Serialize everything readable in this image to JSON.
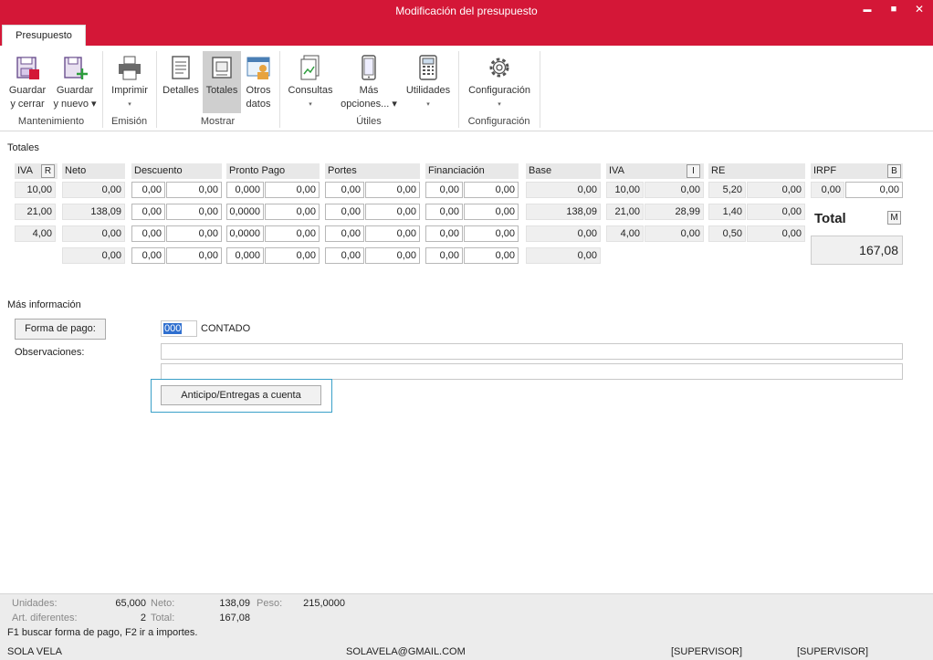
{
  "window": {
    "title": "Modificación del presupuesto",
    "minimize_glyph": "▬",
    "maximize_glyph": "■",
    "close_glyph": "✕"
  },
  "tabs": {
    "active": "Presupuesto"
  },
  "ribbon": {
    "buttons": {
      "guardar_cerrar": {
        "l1": "Guardar",
        "l2": "y cerrar"
      },
      "guardar_nuevo": {
        "l1": "Guardar",
        "l2": "y nuevo ▾"
      },
      "imprimir": {
        "l1": "Imprimir",
        "arrow": "▾"
      },
      "detalles": {
        "l1": "Detalles"
      },
      "totales": {
        "l1": "Totales"
      },
      "otros_datos": {
        "l1": "Otros",
        "l2": "datos"
      },
      "consultas": {
        "l1": "Consultas",
        "arrow": "▾"
      },
      "mas_opciones": {
        "l1": "Más",
        "l2": "opciones... ▾"
      },
      "utilidades": {
        "l1": "Utilidades",
        "arrow": "▾"
      },
      "configuracion": {
        "l1": "Configuración",
        "arrow": "▾"
      }
    },
    "groups": {
      "mantenimiento": "Mantenimiento",
      "emision": "Emisión",
      "mostrar": "Mostrar",
      "utiles": "Útiles",
      "configuracion": "Configuración"
    }
  },
  "totales": {
    "title": "Totales",
    "headers": {
      "iva": "IVA",
      "iva_btn": "R",
      "neto": "Neto",
      "descuento": "Descuento",
      "pronto_pago": "Pronto Pago",
      "portes": "Portes",
      "financiacion": "Financiación",
      "base": "Base",
      "iva2": "IVA",
      "iva2_btn": "I",
      "re": "RE",
      "irpf": "IRPF",
      "irpf_btn": "B"
    },
    "rows": [
      {
        "iva": "10,00",
        "neto": "0,00",
        "dto_p": "0,00",
        "dto_v": "0,00",
        "pp_p": "0,000",
        "pp_v": "0,00",
        "por_p": "0,00",
        "por_v": "0,00",
        "fin_p": "0,00",
        "fin_v": "0,00",
        "base": "0,00",
        "iva_p": "10,00",
        "iva_v": "0,00",
        "re_p": "5,20",
        "re_v": "0,00"
      },
      {
        "iva": "21,00",
        "neto": "138,09",
        "dto_p": "0,00",
        "dto_v": "0,00",
        "pp_p": "0,0000",
        "pp_v": "0,00",
        "por_p": "0,00",
        "por_v": "0,00",
        "fin_p": "0,00",
        "fin_v": "0,00",
        "base": "138,09",
        "iva_p": "21,00",
        "iva_v": "28,99",
        "re_p": "1,40",
        "re_v": "0,00"
      },
      {
        "iva": "4,00",
        "neto": "0,00",
        "dto_p": "0,00",
        "dto_v": "0,00",
        "pp_p": "0,0000",
        "pp_v": "0,00",
        "por_p": "0,00",
        "por_v": "0,00",
        "fin_p": "0,00",
        "fin_v": "0,00",
        "base": "0,00",
        "iva_p": "4,00",
        "iva_v": "0,00",
        "re_p": "0,50",
        "re_v": "0,00"
      }
    ],
    "sum_row": {
      "neto": "0,00",
      "dto_p": "0,00",
      "dto_v": "0,00",
      "pp_p": "0,000",
      "pp_v": "0,00",
      "por_p": "0,00",
      "por_v": "0,00",
      "fin_p": "0,00",
      "fin_v": "0,00",
      "base": "0,00"
    },
    "irpf": {
      "pct": "0,00",
      "val": "0,00"
    },
    "total_label": "Total",
    "total_btn": "M",
    "total_value": "167,08"
  },
  "mas_info": {
    "title": "Más información",
    "forma_pago_btn": "Forma de pago:",
    "forma_pago_code": "000",
    "forma_pago_name": "CONTADO",
    "observaciones_label": "Observaciones:",
    "obs_line1": "",
    "obs_line2": "",
    "anticipo_btn": "Anticipo/Entregas a cuenta"
  },
  "status": {
    "unidades_label": "Unidades:",
    "unidades": "65,000",
    "neto_label": "Neto:",
    "neto": "138,09",
    "peso_label": "Peso:",
    "peso": "215,0000",
    "art_label": "Art. diferentes:",
    "art": "2",
    "total_label": "Total:",
    "total": "167,08",
    "hint": "F1 buscar forma de pago, F2 ir a importes.",
    "user": "SOLA VELA",
    "email": "SOLAVELA@GMAIL.COM",
    "role1": "[SUPERVISOR]",
    "role2": "[SUPERVISOR]"
  }
}
